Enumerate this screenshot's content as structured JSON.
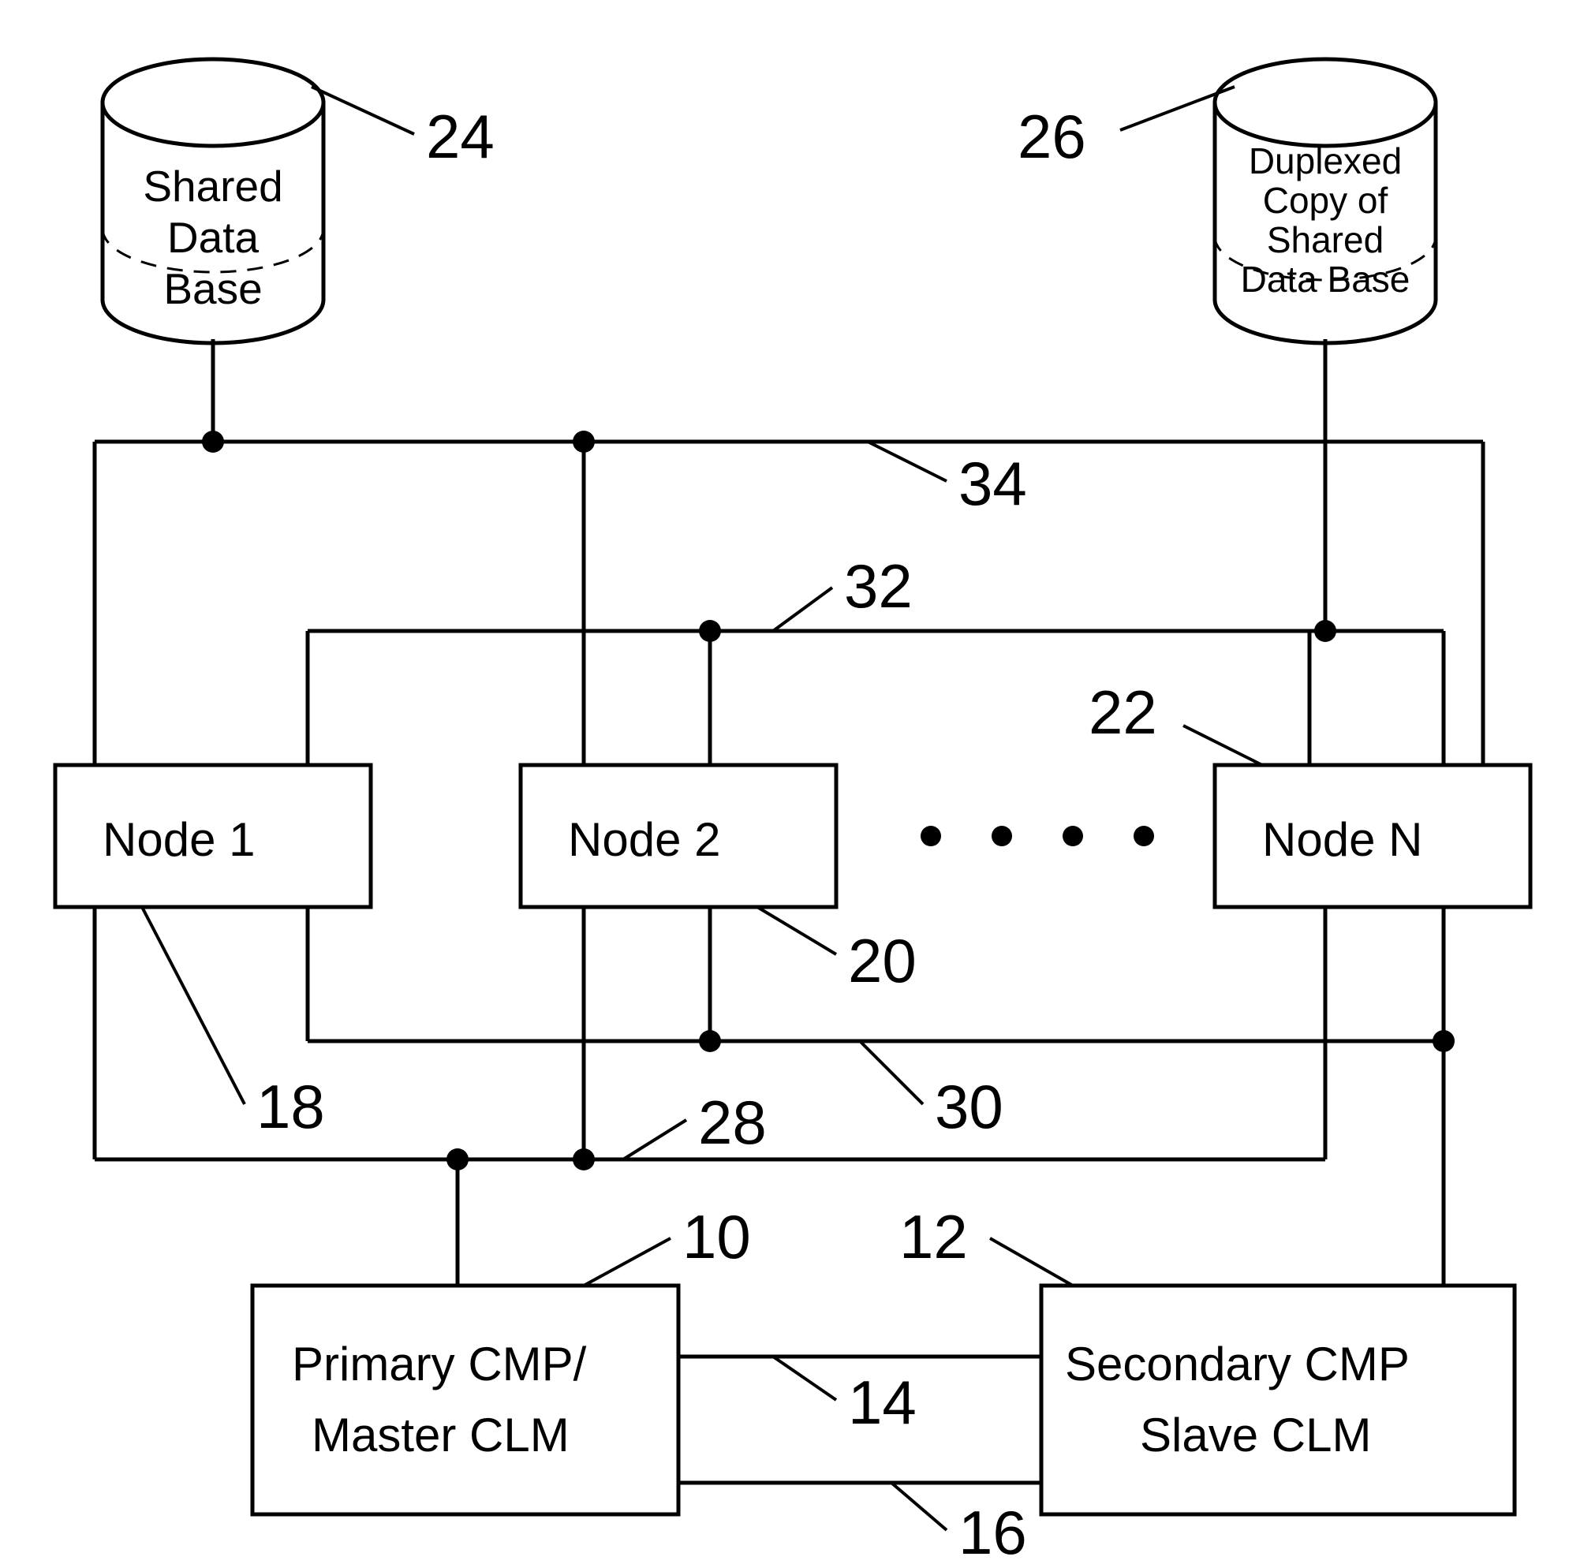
{
  "databases": {
    "left": {
      "lines": [
        "Shared",
        "Data",
        "Base"
      ],
      "ref": "24"
    },
    "right": {
      "lines": [
        "Duplexed",
        "Copy of",
        "Shared",
        "Data Base"
      ],
      "ref": "26"
    }
  },
  "nodes": {
    "n1": {
      "label": "Node 1",
      "ref": "18"
    },
    "n2": {
      "label": "Node 2",
      "ref": "20"
    },
    "nN": {
      "label": "Node N",
      "ref": "22"
    }
  },
  "cmp": {
    "primary": {
      "line1": "Primary CMP/",
      "line2": "Master CLM",
      "ref": "10"
    },
    "secondary": {
      "line1": "Secondary CMP",
      "line2": "Slave CLM",
      "ref": "12"
    }
  },
  "lan_refs": {
    "top": "34",
    "mid": "32",
    "cmp": "30",
    "bottom": "28"
  },
  "cmp_link_refs": {
    "upper": "14",
    "lower": "16"
  }
}
